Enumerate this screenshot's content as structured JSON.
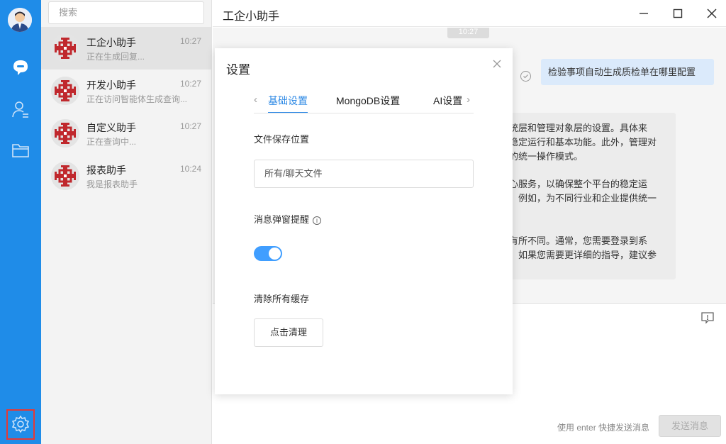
{
  "colors": {
    "rail": "#1f8ce8",
    "accent": "#2f8ae5",
    "toggle_on": "#409eff",
    "highlight_box": "#e53935"
  },
  "rail": {
    "icons": [
      "user-avatar",
      "chat-bubble-icon",
      "contacts-icon",
      "folder-icon",
      "gear-icon"
    ]
  },
  "search": {
    "placeholder": "搜索"
  },
  "conversations": [
    {
      "name": "工企小助手",
      "preview": "正在生成回复...",
      "time": "10:27",
      "active": true
    },
    {
      "name": "开发小助手",
      "preview": "正在访问智能体生成查询...",
      "time": "10:27",
      "active": false
    },
    {
      "name": "自定义助手",
      "preview": "正在查询中...",
      "time": "10:27",
      "active": false
    },
    {
      "name": "报表助手",
      "preview": "我是报表助手",
      "time": "10:24",
      "active": false
    }
  ],
  "header": {
    "title": "工企小助手"
  },
  "chat": {
    "timestamp": "10:27",
    "user_message": "检验事项自动生成质检单在哪里配置",
    "bot_lines": [
      "统层和管理对象层的设置。具体来",
      "稳定运行和基本功能。此外，管理对",
      "的统一操作模式。",
      "",
      "心服务，以确保整个平台的稳定运",
      "。例如，为不同行业和企业提供统一",
      "",
      "",
      "有所不同。通常，您需要登录到系",
      "。如果您需要更详细的指导，建议参"
    ]
  },
  "composer": {
    "hint": "使用 enter 快捷发送消息",
    "send_label": "发送消息"
  },
  "dialog": {
    "title": "设置",
    "tabs": [
      "基础设置",
      "MongoDB设置",
      "AI设置"
    ],
    "active_tab": "基础设置",
    "file_location_label": "文件保存位置",
    "file_location_value": "所有/聊天文件",
    "popup_label": "消息弹窗提醒",
    "popup_enabled": true,
    "cache_label": "清除所有缓存",
    "cache_button": "点击清理"
  }
}
